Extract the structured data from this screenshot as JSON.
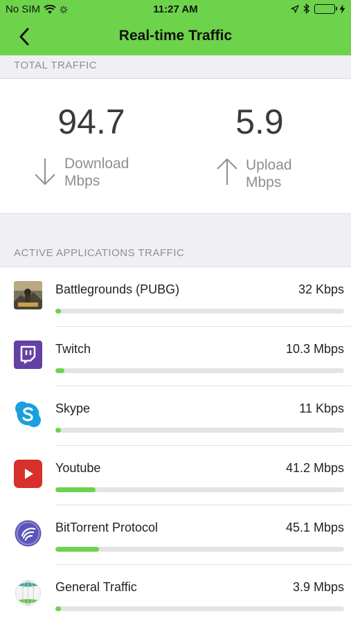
{
  "status_bar": {
    "carrier": "No SIM",
    "time": "11:27 AM"
  },
  "nav": {
    "title": "Real-time Traffic"
  },
  "total_traffic": {
    "section_label": "TOTAL TRAFFIC",
    "download": {
      "value": "94.7",
      "label": "Download",
      "unit": "Mbps"
    },
    "upload": {
      "value": "5.9",
      "label": "Upload",
      "unit": "Mbps"
    }
  },
  "active_apps": {
    "section_label": "ACTIVE APPLICATIONS TRAFFIC",
    "items": [
      {
        "name": "Battlegrounds (PUBG)",
        "rate": "32 Kbps",
        "level": 0.02,
        "icon": "pubg-icon"
      },
      {
        "name": "Twitch",
        "rate": "10.3 Mbps",
        "level": 0.03,
        "icon": "twitch-icon"
      },
      {
        "name": "Skype",
        "rate": "11 Kbps",
        "level": 0.02,
        "icon": "skype-icon"
      },
      {
        "name": "Youtube",
        "rate": "41.2 Mbps",
        "level": 0.14,
        "icon": "youtube-icon"
      },
      {
        "name": "BitTorrent Protocol",
        "rate": "45.1 Mbps",
        "level": 0.15,
        "icon": "bittorrent-icon"
      },
      {
        "name": "General Traffic",
        "rate": "3.9 Mbps",
        "level": 0.02,
        "icon": "globe-icon"
      }
    ]
  },
  "colors": {
    "accent": "#6dd34a",
    "background": "#efeff4"
  }
}
